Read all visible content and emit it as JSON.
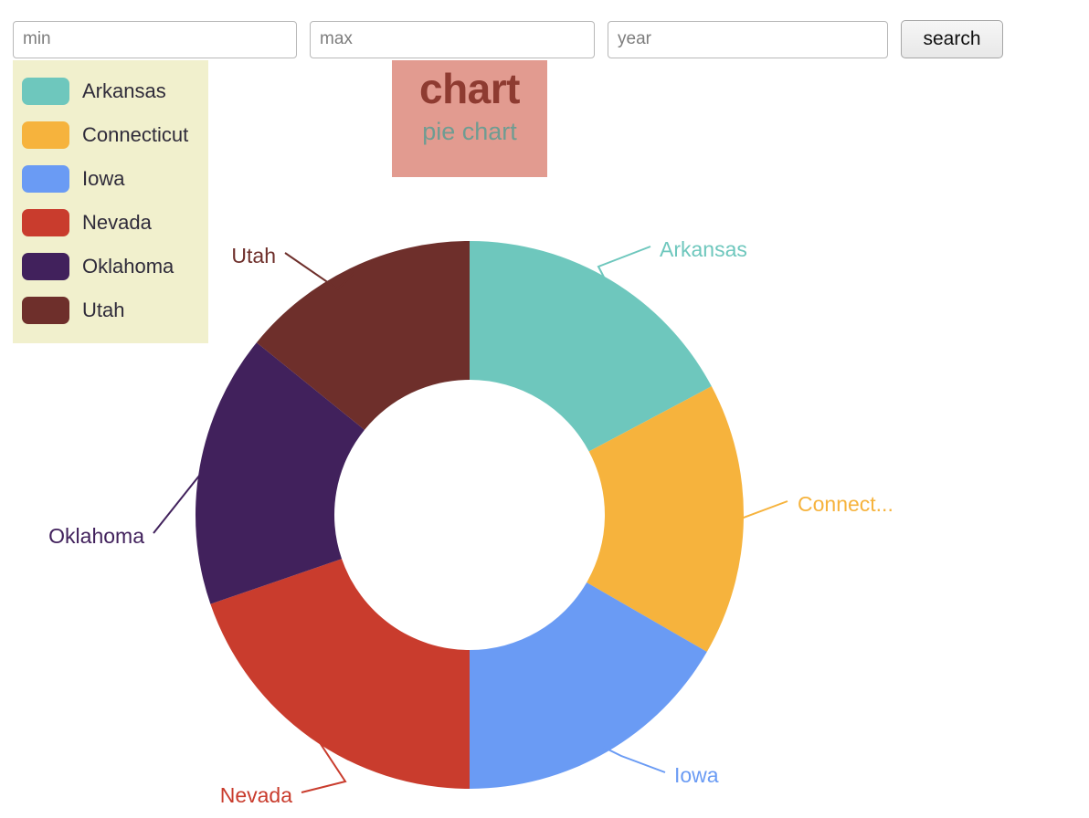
{
  "search": {
    "min": {
      "placeholder": "min",
      "value": ""
    },
    "max": {
      "placeholder": "max",
      "value": ""
    },
    "year": {
      "placeholder": "year",
      "value": ""
    },
    "button_label": "search"
  },
  "title_card": {
    "title": "chart",
    "subtitle": "pie chart",
    "background": "#e29b90",
    "title_color": "#8e3b31",
    "subtitle_color": "#6f9c92"
  },
  "legend": {
    "background": "#f1f0cd",
    "items": [
      {
        "label": "Arkansas",
        "color": "#6ec7bd"
      },
      {
        "label": "Connecticut",
        "color": "#f6b33d"
      },
      {
        "label": "Iowa",
        "color": "#6a9bf4"
      },
      {
        "label": "Nevada",
        "color": "#c93c2d"
      },
      {
        "label": "Oklahoma",
        "color": "#41215c"
      },
      {
        "label": "Utah",
        "color": "#6e2f2b"
      }
    ]
  },
  "chart_data": {
    "type": "pie",
    "title": "chart",
    "subtitle": "pie chart",
    "donut": true,
    "inner_radius": 148,
    "outer_radius": 300,
    "center": [
      514,
      564
    ],
    "legend_position": "top-left",
    "categories": [
      "Arkansas",
      "Connecticut",
      "Iowa",
      "Nevada",
      "Oklahoma",
      "Utah"
    ],
    "values": [
      17.2,
      16.1,
      16.7,
      19.7,
      16.1,
      14.2
    ],
    "angles_deg": [
      62,
      58,
      60,
      71,
      58,
      51
    ],
    "colors": [
      "#6ec7bd",
      "#f6b33d",
      "#6a9bf4",
      "#c93c2d",
      "#41215c",
      "#6e2f2b"
    ],
    "slice_labels": [
      "Arkansas",
      "Connect...",
      "Iowa",
      "Nevada",
      "Oklahoma",
      "Utah"
    ]
  }
}
